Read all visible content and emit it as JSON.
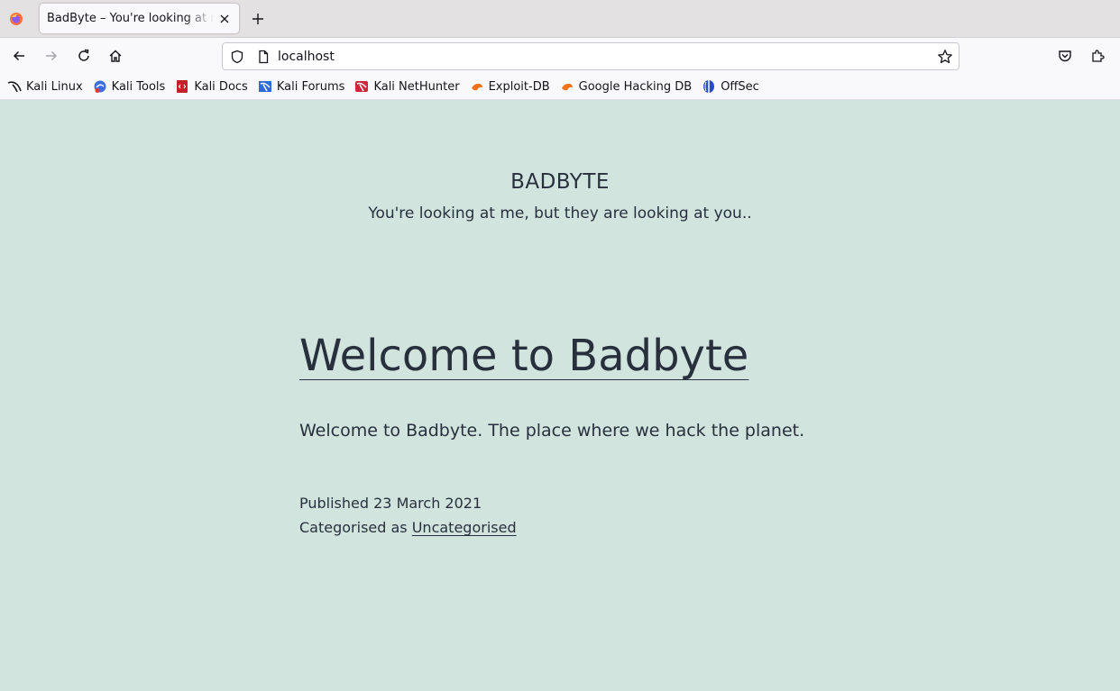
{
  "browser": {
    "tab": {
      "title": "BadByte – You're looking at me, but they are looking at you.."
    },
    "url": "localhost",
    "bookmarks": [
      {
        "label": "Kali Linux",
        "icon": "kali-dragon-icon"
      },
      {
        "label": "Kali Tools",
        "icon": "kali-tools-icon"
      },
      {
        "label": "Kali Docs",
        "icon": "kali-docs-icon"
      },
      {
        "label": "Kali Forums",
        "icon": "kali-forums-icon"
      },
      {
        "label": "Kali NetHunter",
        "icon": "kali-nethunter-icon"
      },
      {
        "label": "Exploit-DB",
        "icon": "exploit-db-icon"
      },
      {
        "label": "Google Hacking DB",
        "icon": "ghdb-icon"
      },
      {
        "label": "OffSec",
        "icon": "offsec-icon"
      }
    ]
  },
  "site": {
    "title": "BADBYTE",
    "description": "You're looking at me, but they are looking at you.."
  },
  "post": {
    "title": "Welcome to Badbyte",
    "body": "Welcome to Badbyte. The place where we hack the planet.",
    "published": "Published 23 March 2021",
    "category_prefix": "Categorised as ",
    "category": "Uncategorised"
  },
  "colors": {
    "page_background": "#d1e4dd",
    "text": "#28303d"
  }
}
